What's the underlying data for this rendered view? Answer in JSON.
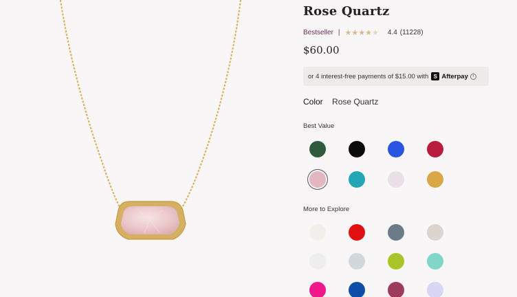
{
  "product": {
    "title": "Rose Quartz",
    "badge": "Bestseller",
    "separator": "|",
    "stars": [
      "★",
      "★",
      "★",
      "★",
      "★"
    ],
    "rating": "4.4",
    "reviews": "(11228)",
    "price": "$60.00"
  },
  "afterpay": {
    "text": "or 4 interest-free payments of $15.00 with",
    "brand": "Afterpay",
    "logo_glyph": "S",
    "info_glyph": "i"
  },
  "color": {
    "label": "Color",
    "value": "Rose Quartz"
  },
  "sections": {
    "best_value": "Best Value",
    "more_to_explore": "More to Explore"
  },
  "swatches": {
    "best_value": [
      {
        "name": "swatch-green",
        "color": "#2f5a3e"
      },
      {
        "name": "swatch-black",
        "color": "#0b0b0b"
      },
      {
        "name": "swatch-blue",
        "color": "#2a55e0"
      },
      {
        "name": "swatch-red-crystal",
        "color": "#b81d40"
      },
      {
        "name": "swatch-rose-quartz",
        "color": "#e3b7bf",
        "selected": true
      },
      {
        "name": "swatch-teal",
        "color": "#23a7b6"
      },
      {
        "name": "swatch-lilac",
        "color": "#eadfe6"
      },
      {
        "name": "swatch-gold",
        "color": "#d9a745"
      }
    ],
    "more_to_explore": [
      {
        "name": "swatch-pearl",
        "color": "#f2efeb"
      },
      {
        "name": "swatch-bright-red",
        "color": "#e01010"
      },
      {
        "name": "swatch-abalone",
        "color": "#6c7b8a"
      },
      {
        "name": "swatch-druzy-silver",
        "color": "#dcd4cf"
      },
      {
        "name": "swatch-white",
        "color": "#eeeeef"
      },
      {
        "name": "swatch-mist",
        "color": "#cfd9dc"
      },
      {
        "name": "swatch-lime",
        "color": "#a9c52a"
      },
      {
        "name": "swatch-aqua-stripe",
        "color": "#7fd6c9"
      },
      {
        "name": "swatch-fuchsia",
        "color": "#f0188a"
      },
      {
        "name": "swatch-navy",
        "color": "#0d4fa8"
      },
      {
        "name": "swatch-multi",
        "color": "#9b3b5d"
      },
      {
        "name": "swatch-lavender",
        "color": "#d8d6f5"
      }
    ]
  }
}
